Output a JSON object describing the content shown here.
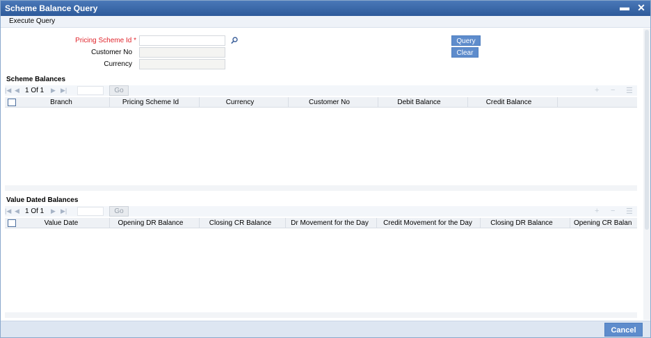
{
  "window": {
    "title": "Scheme Balance Query",
    "minimize_glyph": "▬",
    "close_glyph": "✕"
  },
  "menubar": {
    "execute_query": "Execute Query"
  },
  "form": {
    "pricing_scheme_id_label": "Pricing Scheme Id *",
    "pricing_scheme_id_value": "",
    "customer_no_label": "Customer No",
    "customer_no_value": "",
    "currency_label": "Currency",
    "currency_value": ""
  },
  "actions": {
    "query": "Query",
    "clear": "Clear",
    "cancel": "Cancel"
  },
  "scheme_balances": {
    "title": "Scheme Balances",
    "pager": {
      "page_text": "1 Of 1",
      "go": "Go"
    },
    "columns": [
      "Branch",
      "Pricing Scheme Id",
      "Currency",
      "Customer No",
      "Debit Balance",
      "Credit Balance"
    ]
  },
  "value_dated_balances": {
    "title": "Value Dated Balances",
    "pager": {
      "page_text": "1 Of 1",
      "go": "Go"
    },
    "columns": [
      "Value Date",
      "Opening DR Balance",
      "Closing CR Balance",
      "Dr Movement for the Day",
      "Credit Movement for the Day",
      "Closing DR Balance",
      "Opening CR Balan"
    ]
  },
  "icons": {
    "first": "first-page-icon",
    "prev": "prev-page-icon",
    "next": "next-page-icon",
    "last": "last-page-icon",
    "add": "add-row-icon",
    "delete": "delete-row-icon",
    "view": "single-view-icon",
    "search": "search-icon"
  },
  "colors": {
    "title_bar": "#2d5a9a",
    "button": "#5e8ccc",
    "required": "#e0252c"
  }
}
